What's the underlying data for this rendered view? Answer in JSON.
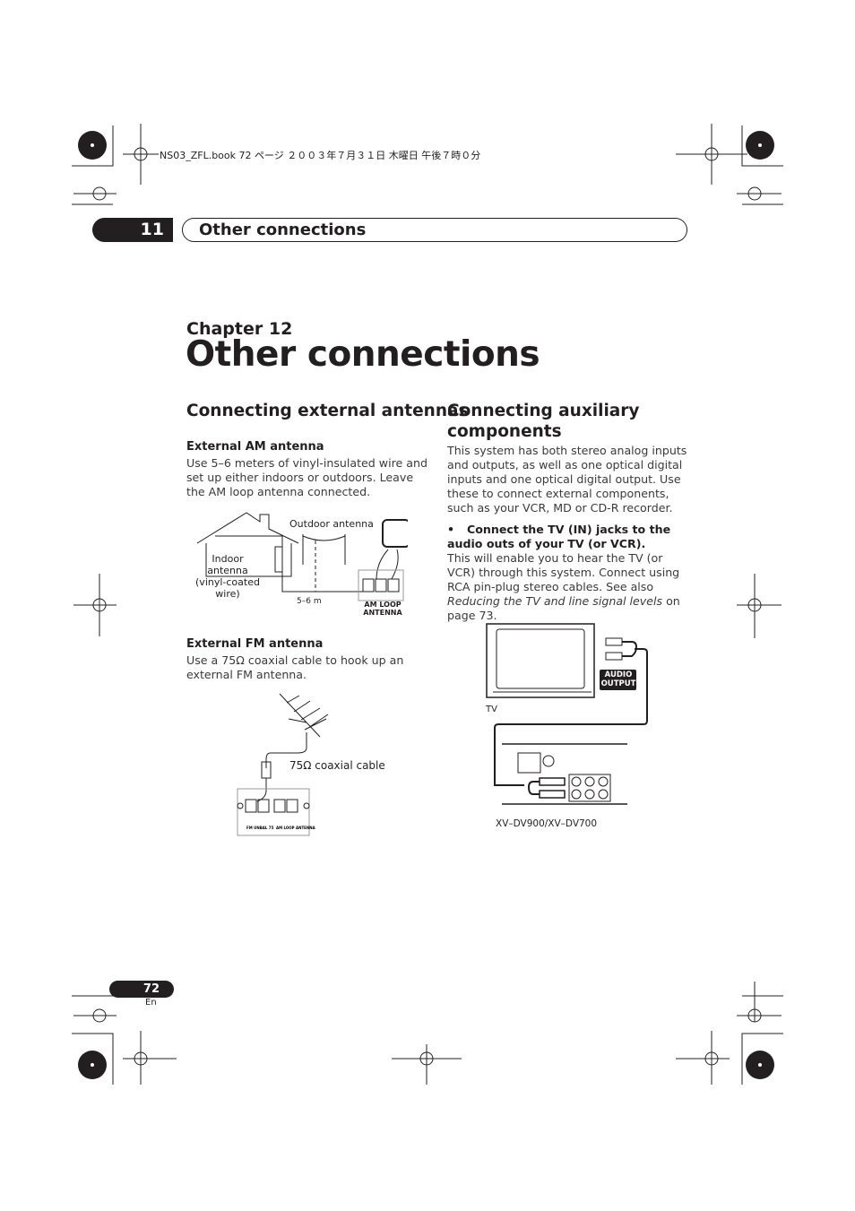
{
  "print_header": "NS03_ZFL.book  72 ページ  ２００３年７月３１日  木曜日  午後７時０分",
  "tab": {
    "number": "11",
    "title": "Other connections"
  },
  "chapter": {
    "label": "Chapter 12",
    "title": "Other connections"
  },
  "left": {
    "heading": "Connecting external antennas",
    "am": {
      "heading": "External AM antenna",
      "body": "Use 5–6 meters of vinyl-insulated wire and set up either indoors or outdoors. Leave the AM loop antenna connected.",
      "labels": {
        "outdoor": "Outdoor antenna",
        "indoor": "Indoor antenna (vinyl-coated wire)",
        "length": "5–6 m",
        "terminal": "AM LOOP ANTENNA"
      }
    },
    "fm": {
      "heading": "External FM antenna",
      "body": "Use a 75Ω coaxial cable to hook up an external FM antenna.",
      "labels": {
        "cable": "75Ω coaxial cable",
        "fm_terminal": "FM UNBAL 75",
        "am_terminal": "AM LOOP ANTENNA"
      }
    }
  },
  "right": {
    "heading": "Connecting auxiliary components",
    "intro": "This system has both stereo analog inputs and outputs, as well as one optical digital inputs and one optical digital output. Use these to connect external components, such as your VCR, MD or CD-R recorder.",
    "bullet": "Connect the TV (IN) jacks to the audio outs of your TV (or VCR).",
    "body_start": "This will enable you to hear the TV (or VCR) through this system. Connect using RCA pin-plug stereo cables. See also ",
    "body_italic": "Reducing the TV and line signal levels",
    "body_end": " on page 73.",
    "diagram": {
      "audio_output": "AUDIO OUTPUT",
      "tv": "TV",
      "model": "XV–DV900/XV–DV700"
    }
  },
  "footer": {
    "page": "72",
    "lang": "En"
  }
}
